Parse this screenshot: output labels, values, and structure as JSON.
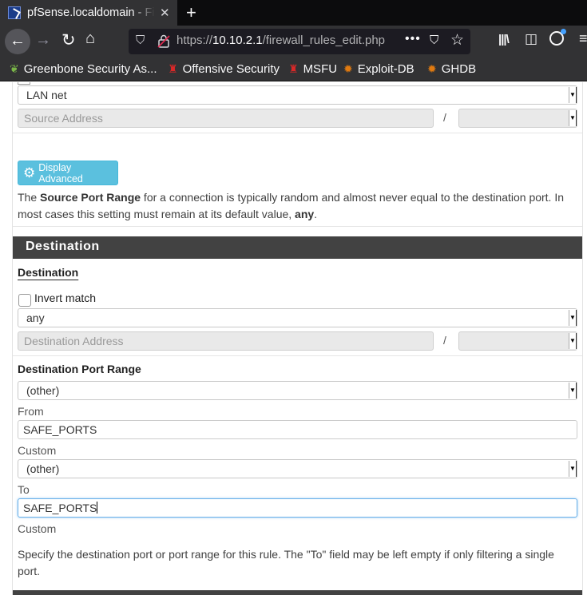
{
  "browser": {
    "tab_title": "pfSense.localdomain - Firewall: Rules: Edit",
    "url_prefix": "https://",
    "url_host": "10.10.2.1",
    "url_path": "/firewall_rules_edit.php"
  },
  "bookmarks": [
    {
      "label": "Greenbone Security As...",
      "icon": "greenbone-icon"
    },
    {
      "label": "Offensive Security",
      "icon": "offsec-icon"
    },
    {
      "label": "MSFU",
      "icon": "msfu-icon"
    },
    {
      "label": "Exploit-DB",
      "icon": "exploitdb-icon"
    },
    {
      "label": "GHDB",
      "icon": "ghdb-icon"
    }
  ],
  "source": {
    "type_value": "LAN net",
    "address_placeholder": "Source Address",
    "slash": "/",
    "display_advanced_label": "Display Advanced",
    "help_pre": "The ",
    "help_bold": "Source Port Range",
    "help_mid": " for a connection is typically random and almost never equal to the destination port. In most cases this setting must remain at its default value, ",
    "help_bold2": "any",
    "help_post": "."
  },
  "destination": {
    "heading": "Destination",
    "label": "Destination",
    "invert_match_label": "Invert match",
    "type_value": "any",
    "address_placeholder": "Destination Address",
    "slash": "/",
    "port_range_label": "Destination Port Range",
    "from_select_value": "(other)",
    "from_label": "From",
    "from_custom_value": "SAFE_PORTS",
    "from_custom_label": "Custom",
    "to_select_value": "(other)",
    "to_label": "To",
    "to_custom_value": "SAFE_PORTS",
    "to_custom_label": "Custom",
    "help": "Specify the destination port or port range for this rule. The \"To\" field may be left empty if only filtering a single port."
  }
}
